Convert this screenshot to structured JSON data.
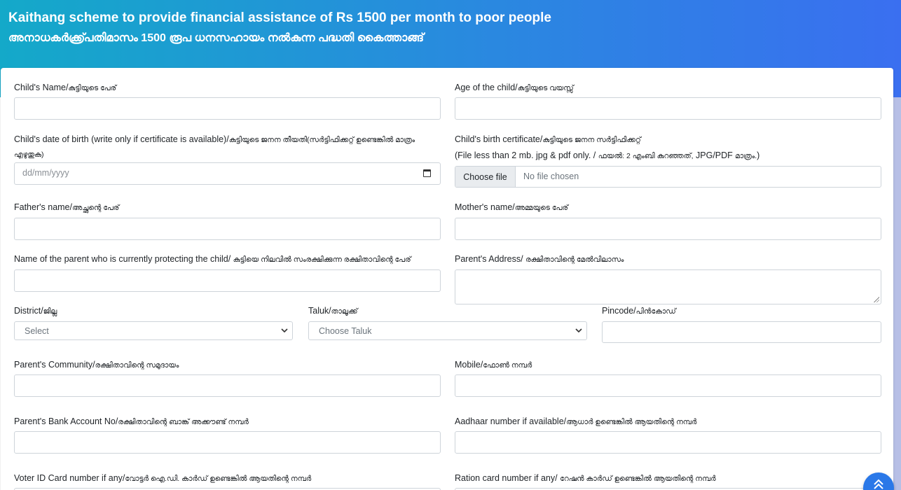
{
  "banner": {
    "title": "Kaithang scheme to provide financial assistance of Rs 1500 per month to poor people",
    "subtitle": "അനാധകർക്ക്പ്രതിമാസം 1500 രൂപ ധനസഹായം നൽകുന്ന പദ്ധതി കൈത്താങ്ങ്"
  },
  "form": {
    "child_name": {
      "en": "Child's Name/",
      "ml": "കുട്ടിയുടെ പേര്"
    },
    "child_age": {
      "en": "Age of the child/",
      "ml": "കുട്ടിയുടെ വയസ്സ്"
    },
    "child_dob": {
      "en": "Child's date of birth (write only if certificate is available)/",
      "ml": "കുട്ടിയുടെ ജനന തീയതി(സർട്ടിഫിക്കറ്റ് ഉണ്ടെങ്കിൽ മാത്രം",
      "ml2": "എഴുതുക)",
      "placeholder": "dd/mm/yyyy"
    },
    "birth_cert": {
      "en": "Child's birth certificate/",
      "ml": "കുട്ടിയുടെ ജനന സർട്ടിഫിക്കറ്റ്",
      "note_en": "(File less than 2 mb. jpg & pdf only. / ",
      "note_ml": "ഫയൽ: 2 എംബി കുറഞ്ഞത്,",
      "note_en2": " JPG/PDF ",
      "note_ml2": "മാത്രം.",
      "note_end": ")",
      "button": "Choose file",
      "status": "No file chosen"
    },
    "father_name": {
      "en": "Father's name/",
      "ml": "അച്ഛന്റെ പേര്"
    },
    "mother_name": {
      "en": "Mother's name/",
      "ml": "അമ്മയുടെ പേര്"
    },
    "guardian_name": {
      "en": "Name of the parent who is currently protecting the child/ ",
      "ml": "കുട്ടിയെ നിലവിൽ സംരക്ഷിക്കുന്ന രക്ഷിതാവിന്റെ പേര്"
    },
    "parent_address": {
      "en": "Parent's Address/ ",
      "ml": "രക്ഷിതാവിന്റെ മേൽവിലാസം"
    },
    "district": {
      "en": "District/",
      "ml": "ജില്ല",
      "selected": "Select"
    },
    "taluk": {
      "en": "Taluk/",
      "ml": "താലൂക്ക്",
      "selected": "Choose Taluk"
    },
    "pincode": {
      "en": "Pincode/",
      "ml": "പിൻകോഡ്"
    },
    "community": {
      "en": "Parent's Community/",
      "ml": "രക്ഷിതാവിന്റെ സമുദായം"
    },
    "mobile": {
      "en": "Mobile/",
      "ml": "ഫോൺ നമ്പർ"
    },
    "bank_account": {
      "en": "Parent's Bank Account No/",
      "ml": "രക്ഷിതാവിന്റെ ബാങ്ക് അക്കൗണ്ട് നമ്പർ"
    },
    "aadhaar": {
      "en": "Aadhaar number if available/",
      "ml": "ആധാർ ഉണ്ടെങ്കിൽ ആയതിന്റെ നമ്പർ"
    },
    "voter_id": {
      "en": "Voter ID Card number if any/",
      "ml": "വോട്ടർ ഐ.ഡി. കാർഡ് ഉണ്ടെങ്കിൽ ആയതിന്റെ നമ്പർ"
    },
    "ration_card": {
      "en": "Ration card number if any/ ",
      "ml": "റേഷൻ കാർഡ് ഉണ്ടെങ്കിൽ ആയതിന്റെ നമ്പർ"
    }
  },
  "icons": {
    "calendar": "calendar-icon",
    "chevron": "chevron-down-icon",
    "scroll_top": "chevron-double-up-icon"
  },
  "colors": {
    "banner_start": "#14a9c9",
    "banner_end": "#3a6ff0",
    "scroll_button": "#2a78e8"
  }
}
